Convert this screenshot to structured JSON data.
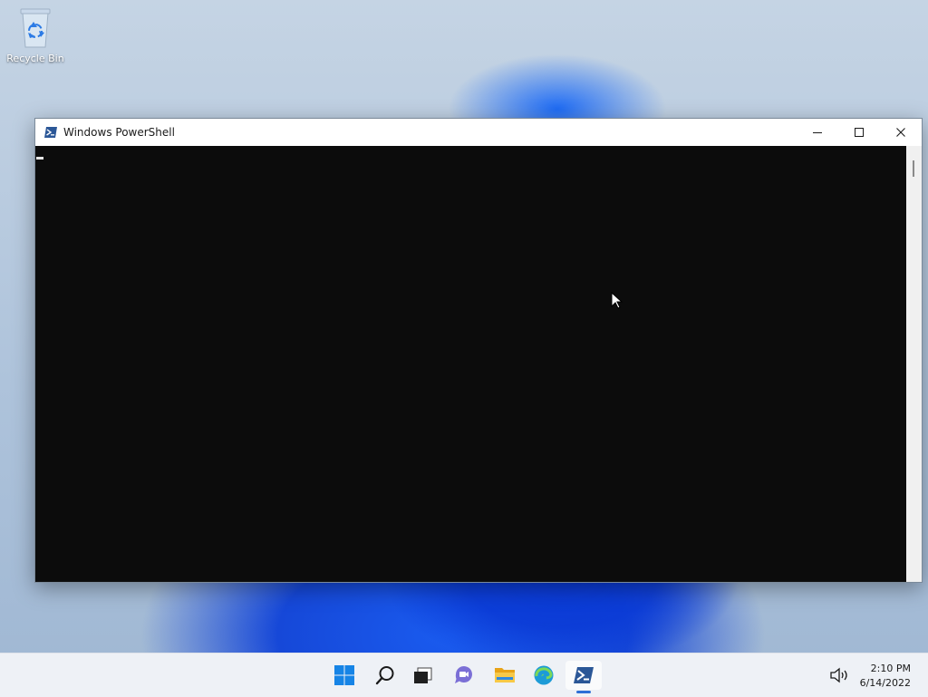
{
  "desktop": {
    "recycle_bin_label": "Recycle Bin"
  },
  "window": {
    "title": "Windows PowerShell",
    "console_background": "#0c0c0c",
    "controls": [
      "minimize-icon",
      "maximize-icon",
      "close-icon"
    ]
  },
  "taskbar": {
    "items": [
      "start-icon",
      "search-icon",
      "task-view-icon",
      "chat-icon",
      "file-explorer-icon",
      "edge-icon",
      "powershell-icon"
    ],
    "active_item": "powershell-icon",
    "tray": {
      "volume_icon": "volume-icon"
    },
    "clock": {
      "time": "2:10 PM",
      "date": "6/14/2022"
    }
  },
  "colors": {
    "accent": "#2d6fd6",
    "wallpaper_bloom": "#1a5cf0"
  }
}
